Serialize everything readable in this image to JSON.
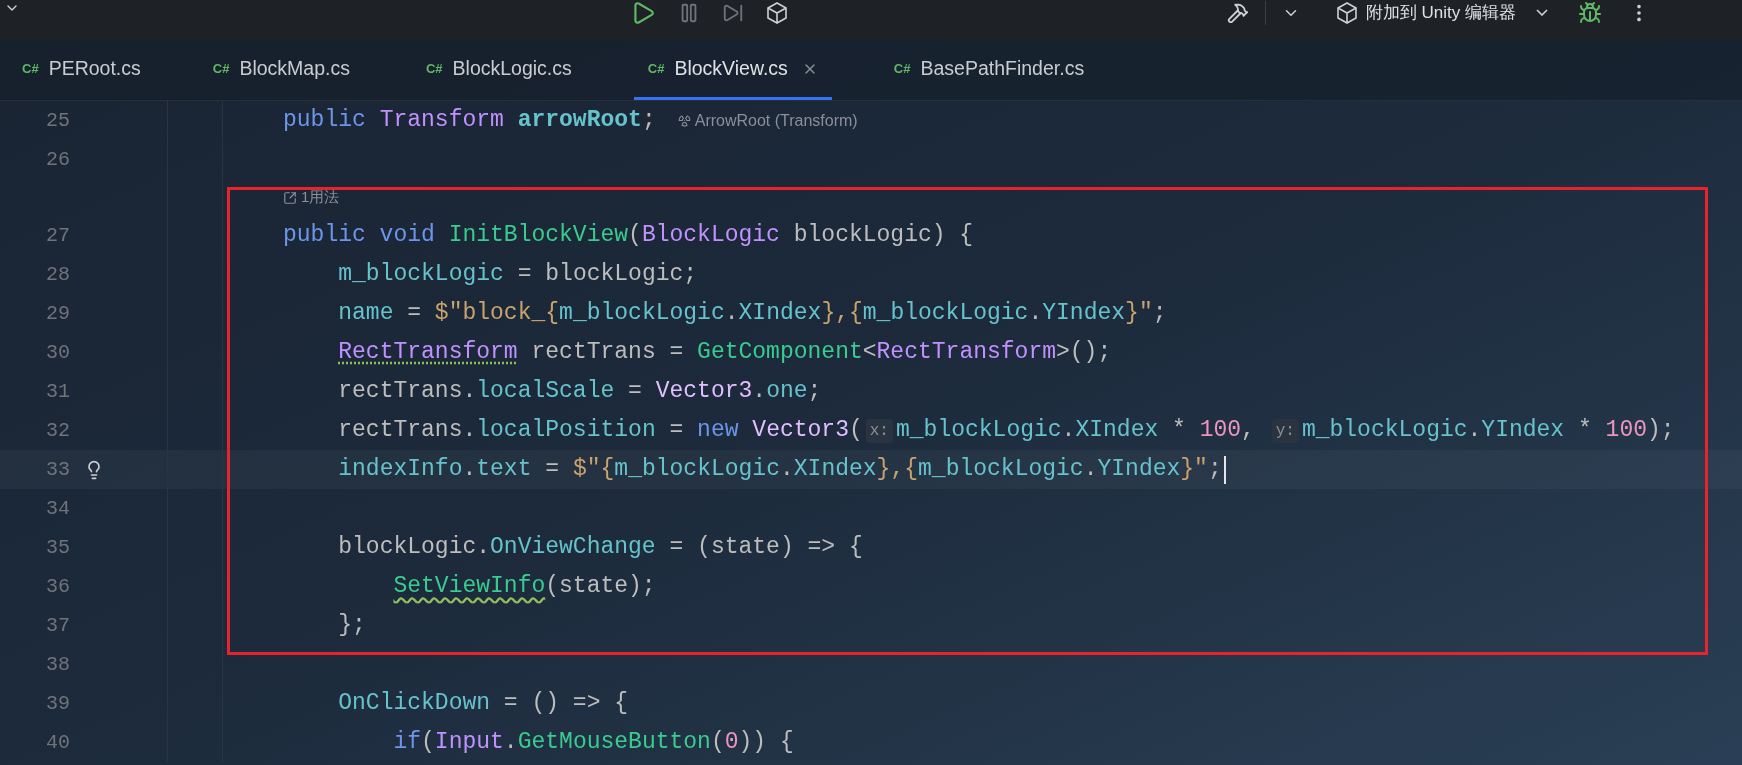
{
  "toolbar": {
    "attach_label": "附加到 Unity 编辑器"
  },
  "tabs": [
    {
      "badge": "C#",
      "label": "PERoot.cs",
      "selected": false
    },
    {
      "badge": "C#",
      "label": "BlockMap.cs",
      "selected": false
    },
    {
      "badge": "C#",
      "label": "BlockLogic.cs",
      "selected": false
    },
    {
      "badge": "C#",
      "label": "BlockView.cs",
      "selected": true
    },
    {
      "badge": "C#",
      "label": "BasePathFinder.cs",
      "selected": false
    }
  ],
  "editor": {
    "lines": [
      {
        "kind": "code",
        "number": "25",
        "current": false,
        "hint": "ArrowRoot (Transform)",
        "tokens": [
          {
            "text": "public ",
            "kind": "kw"
          },
          {
            "text": "Transform ",
            "kind": "type"
          },
          {
            "text": "arrowRoot",
            "kind": "decl"
          },
          {
            "text": ";",
            "kind": "plain"
          }
        ]
      },
      {
        "kind": "code",
        "number": "26",
        "current": false
      },
      {
        "kind": "code_vision",
        "text": "1用法"
      },
      {
        "kind": "code",
        "number": "27",
        "current": false,
        "tokens": [
          {
            "text": "public void ",
            "kind": "kw"
          },
          {
            "text": "InitBlockView",
            "kind": "method"
          },
          {
            "text": "(",
            "kind": "plain"
          },
          {
            "text": "BlockLogic",
            "kind": "type"
          },
          {
            "text": " blockLogic) {",
            "kind": "plain"
          }
        ]
      },
      {
        "kind": "code",
        "number": "28",
        "current": false,
        "tokens": [
          {
            "text": "    m_blockLogic",
            "kind": "field"
          },
          {
            "text": " = blockLogic;",
            "kind": "plain"
          }
        ]
      },
      {
        "kind": "code",
        "number": "29",
        "current": false,
        "tokens": [
          {
            "text": "    name",
            "kind": "field"
          },
          {
            "text": " = ",
            "kind": "plain"
          },
          {
            "text": "$\"block_{",
            "kind": "str"
          },
          {
            "text": "m_blockLogic",
            "kind": "field"
          },
          {
            "text": ".",
            "kind": "plain"
          },
          {
            "text": "XIndex",
            "kind": "field"
          },
          {
            "text": "},{",
            "kind": "str"
          },
          {
            "text": "m_blockLogic",
            "kind": "field"
          },
          {
            "text": ".",
            "kind": "plain"
          },
          {
            "text": "YIndex",
            "kind": "field"
          },
          {
            "text": "}\"",
            "kind": "str"
          },
          {
            "text": ";",
            "kind": "plain"
          }
        ]
      },
      {
        "kind": "code",
        "number": "30",
        "current": false,
        "tokens": [
          {
            "text": "    RectTransform",
            "kind": "type_warning"
          },
          {
            "text": " rectTrans = ",
            "kind": "plain"
          },
          {
            "text": "GetComponent",
            "kind": "method"
          },
          {
            "text": "<",
            "kind": "plain"
          },
          {
            "text": "RectTransform",
            "kind": "type"
          },
          {
            "text": ">();",
            "kind": "plain"
          }
        ]
      },
      {
        "kind": "code",
        "number": "31",
        "current": false,
        "tokens": [
          {
            "text": "    rectTrans.",
            "kind": "plain"
          },
          {
            "text": "localScale",
            "kind": "field"
          },
          {
            "text": " = ",
            "kind": "plain"
          },
          {
            "text": "Vector3",
            "kind": "struct"
          },
          {
            "text": ".",
            "kind": "plain"
          },
          {
            "text": "one",
            "kind": "field"
          },
          {
            "text": ";",
            "kind": "plain"
          }
        ]
      },
      {
        "kind": "code",
        "number": "32",
        "current": false,
        "tokens": [
          {
            "text": "    rectTrans.",
            "kind": "plain"
          },
          {
            "text": "localPosition",
            "kind": "field"
          },
          {
            "text": " = ",
            "kind": "plain"
          },
          {
            "text": "new ",
            "kind": "kw"
          },
          {
            "text": "Vector3",
            "kind": "struct"
          },
          {
            "text": "(",
            "kind": "plain"
          },
          {
            "text": "x:",
            "kind": "hint"
          },
          {
            "text": "m_blockLogic",
            "kind": "field"
          },
          {
            "text": ".",
            "kind": "plain"
          },
          {
            "text": "XIndex",
            "kind": "field"
          },
          {
            "text": " * ",
            "kind": "plain"
          },
          {
            "text": "100",
            "kind": "num"
          },
          {
            "text": ", ",
            "kind": "plain"
          },
          {
            "text": "y:",
            "kind": "hint"
          },
          {
            "text": "m_blockLogic",
            "kind": "field"
          },
          {
            "text": ".",
            "kind": "plain"
          },
          {
            "text": "YIndex",
            "kind": "field"
          },
          {
            "text": " * ",
            "kind": "plain"
          },
          {
            "text": "100",
            "kind": "num"
          },
          {
            "text": ");",
            "kind": "plain"
          }
        ]
      },
      {
        "kind": "code",
        "number": "33",
        "current": true,
        "tokens": [
          {
            "text": "    indexInfo",
            "kind": "field"
          },
          {
            "text": ".",
            "kind": "plain"
          },
          {
            "text": "text",
            "kind": "field"
          },
          {
            "text": " = ",
            "kind": "plain"
          },
          {
            "text": "$\"{",
            "kind": "str"
          },
          {
            "text": "m_blockLogic",
            "kind": "field"
          },
          {
            "text": ".",
            "kind": "plain"
          },
          {
            "text": "XIndex",
            "kind": "field"
          },
          {
            "text": "},{",
            "kind": "str"
          },
          {
            "text": "m_blockLogic",
            "kind": "field"
          },
          {
            "text": ".",
            "kind": "plain"
          },
          {
            "text": "YIndex",
            "kind": "field"
          },
          {
            "text": "}\"",
            "kind": "str"
          },
          {
            "text": ";",
            "kind": "plain"
          }
        ]
      },
      {
        "kind": "code",
        "number": "34",
        "current": false
      },
      {
        "kind": "code",
        "number": "35",
        "current": false,
        "tokens": [
          {
            "text": "    blockLogic.",
            "kind": "plain"
          },
          {
            "text": "OnViewChange",
            "kind": "field"
          },
          {
            "text": " = (state) => {",
            "kind": "plain"
          }
        ]
      },
      {
        "kind": "code",
        "number": "36",
        "current": false,
        "tokens": [
          {
            "text": "        SetViewInfo",
            "kind": "method_warning"
          },
          {
            "text": "(state);",
            "kind": "plain"
          }
        ]
      },
      {
        "kind": "code",
        "number": "37",
        "current": false,
        "tokens": [
          {
            "text": "    };",
            "kind": "plain"
          }
        ]
      },
      {
        "kind": "code",
        "number": "38",
        "current": false
      },
      {
        "kind": "code",
        "number": "39",
        "current": false,
        "tokens": [
          {
            "text": "    OnClickDown",
            "kind": "field"
          },
          {
            "text": " = () => {",
            "kind": "plain"
          }
        ]
      },
      {
        "kind": "code",
        "number": "40",
        "current": false,
        "tokens": [
          {
            "text": "        if",
            "kind": "kw"
          },
          {
            "text": "(",
            "kind": "plain"
          },
          {
            "text": "Input",
            "kind": "type"
          },
          {
            "text": ".",
            "kind": "plain"
          },
          {
            "text": "GetMouseButton",
            "kind": "method"
          },
          {
            "text": "(",
            "kind": "plain"
          },
          {
            "text": "0",
            "kind": "num"
          },
          {
            "text": ")) {",
            "kind": "plain"
          }
        ]
      }
    ]
  }
}
